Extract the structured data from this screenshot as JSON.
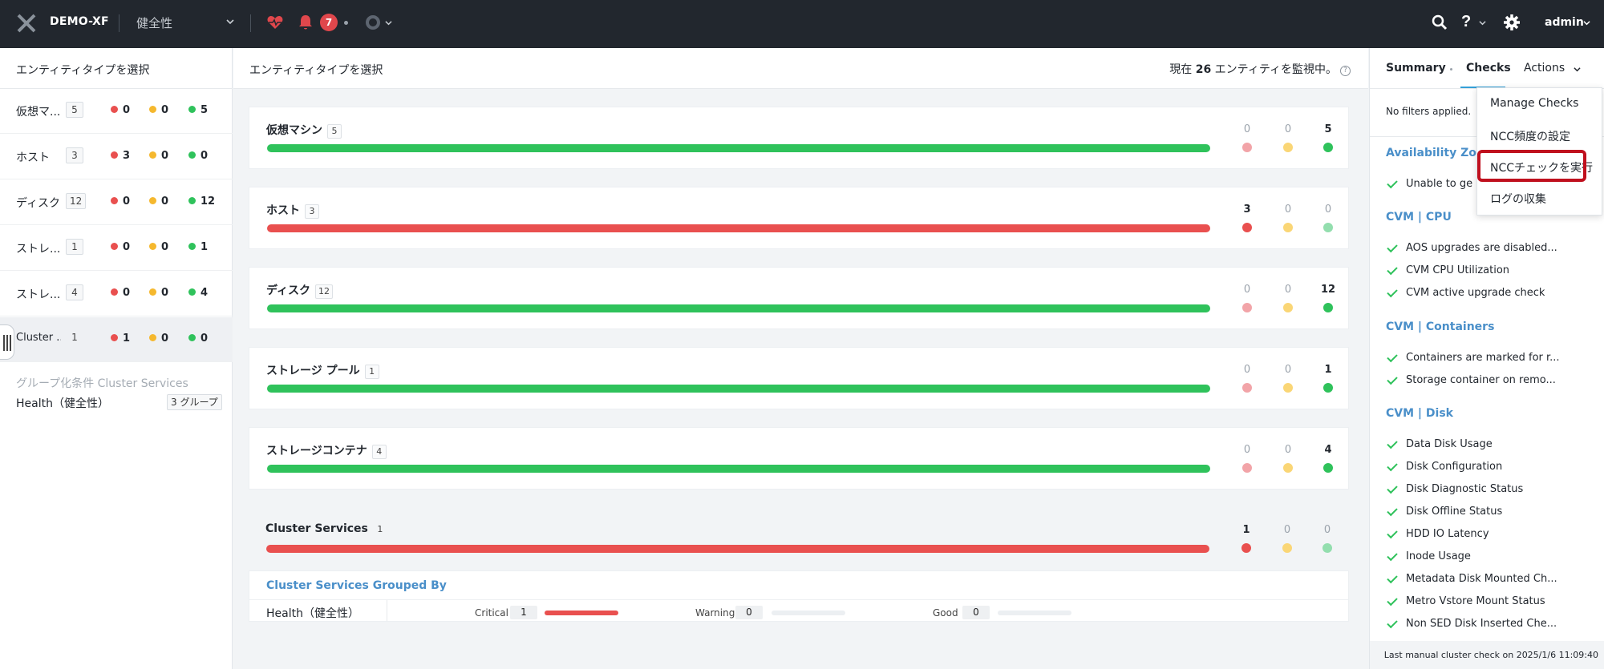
{
  "topbar": {
    "cluster_name": "DEMO-XF",
    "current_view": "健全性",
    "alert_count": "7",
    "user": "admin"
  },
  "sidebar": {
    "title": "エンティティタイプを選択",
    "items": [
      {
        "name": "仮想マ...",
        "count": "5",
        "critical": "0",
        "warning": "0",
        "good": "5"
      },
      {
        "name": "ホスト",
        "count": "3",
        "critical": "3",
        "warning": "0",
        "good": "0"
      },
      {
        "name": "ディスク",
        "count": "12",
        "critical": "0",
        "warning": "0",
        "good": "12"
      },
      {
        "name": "ストレ...",
        "count": "1",
        "critical": "0",
        "warning": "0",
        "good": "1"
      },
      {
        "name": "ストレ...",
        "count": "4",
        "critical": "0",
        "warning": "0",
        "good": "4"
      },
      {
        "name": "Cluster ...",
        "count": "1",
        "critical": "1",
        "warning": "0",
        "good": "0"
      }
    ],
    "group_by_label": "グループ化条件 Cluster Services",
    "group_by_value": "Health（健全性）",
    "group_by_badge": "3 グループ"
  },
  "main": {
    "title": "エンティティタイプを選択",
    "status_prefix": "現在",
    "status_count": "26",
    "status_suffix": "エンティティを監視中。",
    "cards": [
      {
        "name": "仮想マシン",
        "count": "5",
        "critical": "0",
        "warning": "0",
        "good": "5"
      },
      {
        "name": "ホスト",
        "count": "3",
        "critical": "3",
        "warning": "0",
        "good": "0"
      },
      {
        "name": "ディスク",
        "count": "12",
        "critical": "0",
        "warning": "0",
        "good": "12"
      },
      {
        "name": "ストレージ プール",
        "count": "1",
        "critical": "0",
        "warning": "0",
        "good": "1"
      },
      {
        "name": "ストレージコンテナ",
        "count": "4",
        "critical": "0",
        "warning": "0",
        "good": "4"
      },
      {
        "name": "Cluster Services",
        "count": "1",
        "critical": "1",
        "warning": "0",
        "good": "0"
      }
    ],
    "grouped": {
      "title": "Cluster Services Grouped By",
      "health_label": "Health（健全性）",
      "critical_label": "Critical",
      "critical_value": "1",
      "warning_label": "Warning",
      "warning_value": "0",
      "good_label": "Good",
      "good_value": "0"
    }
  },
  "right_panel": {
    "tabs": {
      "summary": "Summary",
      "checks": "Checks",
      "actions": "Actions"
    },
    "filter_text": "No filters applied. Sh",
    "sections": [
      {
        "title": "Availability Zone",
        "items": [
          "Unable to ge"
        ]
      },
      {
        "title": "CVM | CPU",
        "items": [
          "AOS upgrades are disabled...",
          "CVM CPU Utilization",
          "CVM active upgrade check"
        ]
      },
      {
        "title": "CVM | Containers",
        "items": [
          "Containers are marked for r...",
          "Storage container on remo..."
        ]
      },
      {
        "title": "CVM | Disk",
        "items": [
          "Data Disk Usage",
          "Disk Configuration",
          "Disk Diagnostic Status",
          "Disk Offline Status",
          "HDD IO Latency",
          "Inode Usage",
          "Metadata Disk Mounted Ch...",
          "Metro Vstore Mount Status",
          "Non SED Disk Inserted Che..."
        ]
      }
    ],
    "footer": "Last manual cluster check on 2025/1/6 11:09:40"
  },
  "actions_menu": {
    "items": [
      "Manage Checks",
      "NCC頻度の設定",
      "NCCチェックを実行",
      "ログの収集"
    ]
  },
  "colors": {
    "critical": "#e9504f",
    "warning": "#f5b82e",
    "good": "#2fc25b",
    "accent": "#35a0d8",
    "highlight": "#c0101e"
  }
}
